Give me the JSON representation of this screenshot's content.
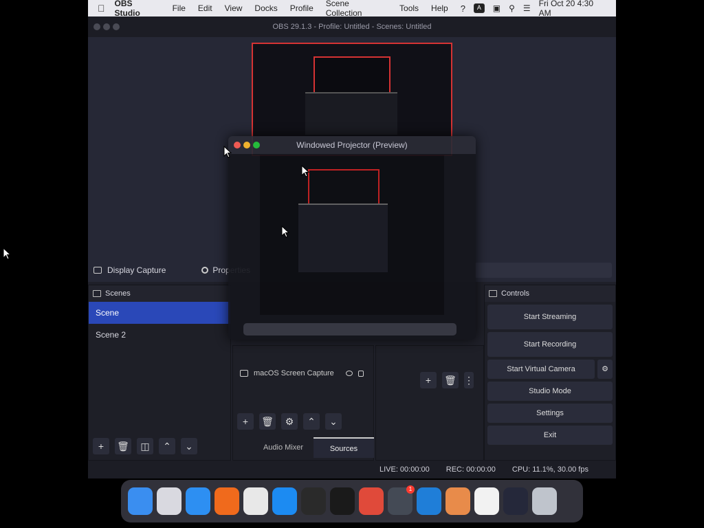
{
  "menubar": {
    "app_name": "OBS Studio",
    "menus": [
      "File",
      "Edit",
      "View",
      "Docks",
      "Profile",
      "Scene Collection",
      "Tools",
      "Help"
    ],
    "clock": "Fri Oct 20  4:30 AM"
  },
  "window": {
    "title": "OBS 29.1.3 - Profile: Untitled - Scenes: Untitled"
  },
  "source_toolbar": {
    "source_name": "Display Capture",
    "properties_label": "Properties"
  },
  "scenes_dock": {
    "title": "Scenes",
    "items": [
      "Scene",
      "Scene 2"
    ]
  },
  "sources_dock": {
    "items": [
      {
        "name": "macOS Screen Capture"
      }
    ]
  },
  "bottom_tabs": [
    "Audio Mixer",
    "Sources"
  ],
  "controls_dock": {
    "title": "Controls",
    "start_streaming": "Start Streaming",
    "start_recording": "Start Recording",
    "start_virtual_camera": "Start Virtual Camera",
    "studio_mode": "Studio Mode",
    "settings": "Settings",
    "exit": "Exit"
  },
  "statusbar": {
    "live": "LIVE: 00:00:00",
    "rec": "REC: 00:00:00",
    "cpu": "CPU: 11.1%, 30.00 fps"
  },
  "projector": {
    "title": "Windowed Projector (Preview)"
  },
  "dock_apps": [
    {
      "name": "finder-icon",
      "color": "#3a8ef0"
    },
    {
      "name": "launchpad-icon",
      "color": "#d9d9e0"
    },
    {
      "name": "safari-icon",
      "color": "#2d8ff2"
    },
    {
      "name": "firefox-icon",
      "color": "#f06a1c"
    },
    {
      "name": "textedit-icon",
      "color": "#e8e8e8"
    },
    {
      "name": "appstore-icon",
      "color": "#1c8bf2"
    },
    {
      "name": "logic-icon",
      "color": "#2a2a2a"
    },
    {
      "name": "terminal-icon",
      "color": "#1a1a1a"
    },
    {
      "name": "chrome-icon",
      "color": "#e04a3a"
    },
    {
      "name": "webcatalog-icon",
      "color": "#444a55"
    },
    {
      "name": "vscode-icon",
      "color": "#1f7ed8"
    },
    {
      "name": "pixelmator-icon",
      "color": "#e88b4a"
    },
    {
      "name": "sketch-icon",
      "color": "#f2f2f2"
    },
    {
      "name": "obs-icon",
      "color": "#25283a"
    },
    {
      "name": "trash-icon",
      "color": "#bfc4cc"
    }
  ],
  "dock_badge": "1"
}
